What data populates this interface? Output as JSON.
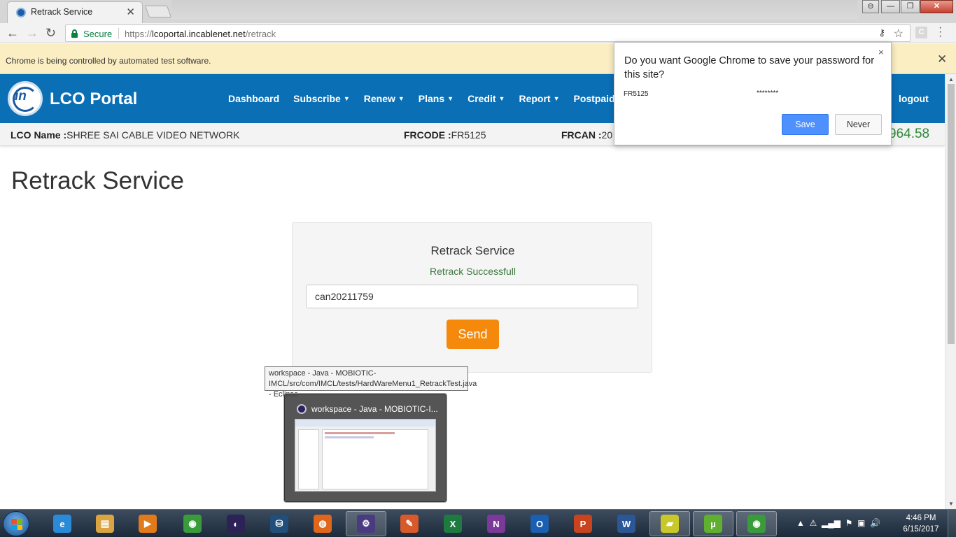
{
  "browser": {
    "tab_title": "Retrack Service",
    "tab_close": "✕",
    "address_secure_label": "Secure",
    "address_url_prefix": "https://",
    "address_url_host": "lcoportal.incablenet.net",
    "address_url_path": "/retrack",
    "infobar_text": "Chrome is being controlled by automated test software.",
    "infobar_close": "✕",
    "window_controls": {
      "minimize": "—",
      "maximize": "❐",
      "close": "✕"
    }
  },
  "site": {
    "brand": "LCO Portal",
    "logo_text": "in",
    "nav": [
      {
        "label": "Dashboard",
        "caret": false
      },
      {
        "label": "Subscribe",
        "caret": true
      },
      {
        "label": "Renew",
        "caret": true
      },
      {
        "label": "Plans",
        "caret": true
      },
      {
        "label": "Credit",
        "caret": true
      },
      {
        "label": "Report",
        "caret": true
      },
      {
        "label": "Postpaid",
        "caret": false
      }
    ],
    "logout": "logout",
    "info": {
      "lco_label": "LCO Name :",
      "lco_value": "SHREE SAI CABLE VIDEO NETWORK",
      "frcode_label": "FRCODE :",
      "frcode_value": "FR5125",
      "frcan_label": "FRCAN :",
      "frcan_value": "20",
      "balance": "964.58"
    }
  },
  "main": {
    "page_title": "Retrack Service",
    "card_title": "Retrack Service",
    "card_message": "Retrack Successfull",
    "input_value": "can20211759",
    "send_label": "Send"
  },
  "password_popup": {
    "question": "Do you want Google Chrome to save your password for this site?",
    "username": "FR5125",
    "password_mask": "********",
    "save_label": "Save",
    "never_label": "Never",
    "close": "×"
  },
  "taskbar_preview": {
    "tooltip": "workspace - Java - MOBIOTIC-IMCL/src/com/IMCL/tests/HardWareMenu1_RetrackTest.java - Eclipse",
    "thumb_title": "workspace - Java - MOBIOTIC-I..."
  },
  "taskbar": {
    "apps": [
      {
        "name": "internet-explorer",
        "glyph": "e",
        "color": "#2a8ad8"
      },
      {
        "name": "file-explorer",
        "glyph": "▤",
        "color": "#d9a441"
      },
      {
        "name": "media-player",
        "glyph": "▶",
        "color": "#e07a1a"
      },
      {
        "name": "chrome",
        "glyph": "◉",
        "color": "#3a9b3a"
      },
      {
        "name": "eclipse",
        "glyph": "◐",
        "color": "#2c2255"
      },
      {
        "name": "mysql-workbench",
        "glyph": "⛁",
        "color": "#1f4f7a"
      },
      {
        "name": "firefox",
        "glyph": "◍",
        "color": "#e0661c"
      },
      {
        "name": "eclipse-javaee",
        "glyph": "⚙",
        "color": "#4a3a80"
      },
      {
        "name": "keyword-tool",
        "glyph": "✎",
        "color": "#d85a2a"
      },
      {
        "name": "excel",
        "glyph": "X",
        "color": "#1f7a3f"
      },
      {
        "name": "onenote",
        "glyph": "N",
        "color": "#7b3a9a"
      },
      {
        "name": "outlook",
        "glyph": "O",
        "color": "#1a5fb0"
      },
      {
        "name": "powerpoint",
        "glyph": "P",
        "color": "#c8431e"
      },
      {
        "name": "word",
        "glyph": "W",
        "color": "#2b5797"
      },
      {
        "name": "sticky-notes",
        "glyph": "▰",
        "color": "#c8c82a"
      },
      {
        "name": "utorrent",
        "glyph": "µ",
        "color": "#5fb030"
      },
      {
        "name": "chrome-active",
        "glyph": "◉",
        "color": "#3a9b3a"
      }
    ],
    "time": "4:46 PM",
    "date": "6/15/2017"
  }
}
